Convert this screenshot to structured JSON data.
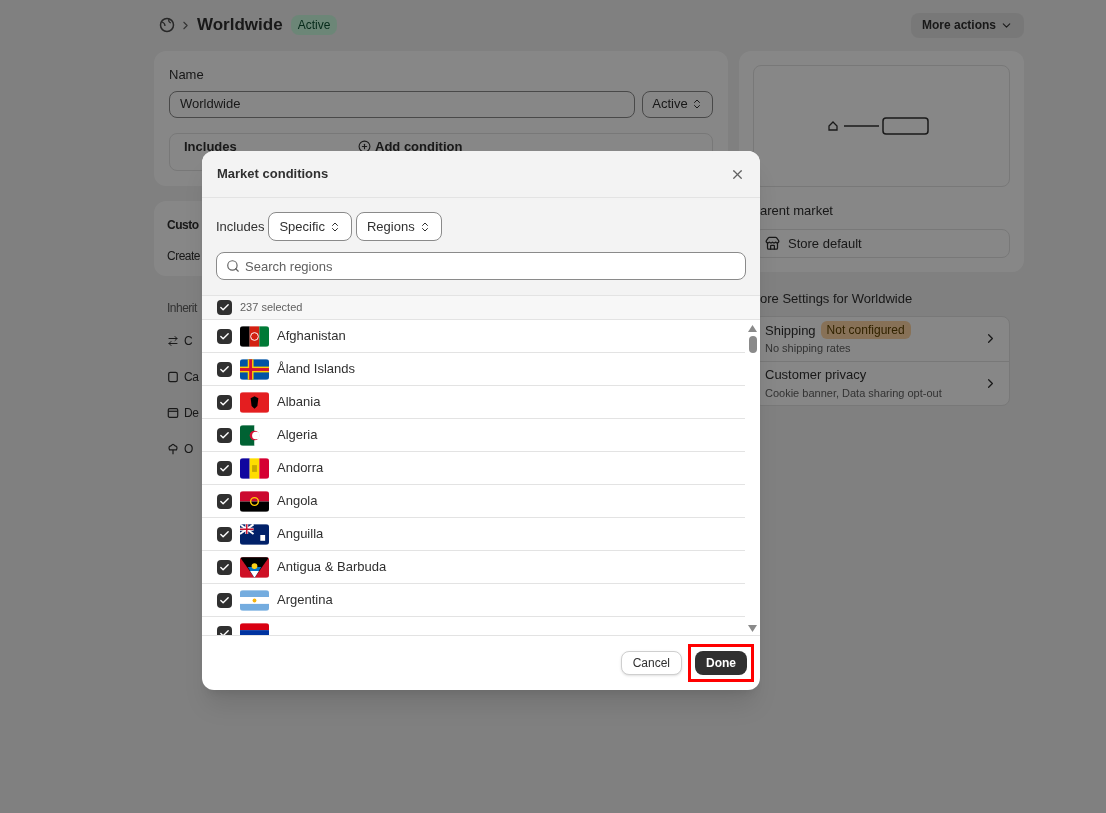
{
  "header": {
    "title": "Worldwide",
    "status": "Active",
    "more_actions": "More actions"
  },
  "name_card": {
    "label": "Name",
    "value": "Worldwide",
    "status_select": "Active",
    "includes_label": "Includes",
    "add_condition": "Add condition"
  },
  "customers_card": {
    "title": "Custo",
    "text": "Create"
  },
  "inherit": {
    "title": "Inherit",
    "items": [
      "C",
      "Ca",
      "De",
      "O"
    ]
  },
  "parent_market": {
    "label": "arent market",
    "button": "Store default"
  },
  "more_settings": {
    "title": "ore Settings for Worldwide",
    "rows": [
      {
        "title": "Shipping",
        "badge": "Not configured",
        "subtitle": "No shipping rates"
      },
      {
        "title": "Customer privacy",
        "subtitle": "Cookie banner, Data sharing opt-out"
      }
    ]
  },
  "modal": {
    "title": "Market conditions",
    "includes_label": "Includes",
    "selects": [
      "Specific",
      "Regions"
    ],
    "search_placeholder": "Search regions",
    "select_all": {
      "label": "237 selected",
      "checked": true
    },
    "countries": [
      {
        "name": "Afghanistan",
        "checked": true
      },
      {
        "name": "Åland Islands",
        "checked": true
      },
      {
        "name": "Albania",
        "checked": true
      },
      {
        "name": "Algeria",
        "checked": true
      },
      {
        "name": "Andorra",
        "checked": true
      },
      {
        "name": "Angola",
        "checked": true
      },
      {
        "name": "Anguilla",
        "checked": true
      },
      {
        "name": "Antigua & Barbuda",
        "checked": true
      },
      {
        "name": "Argentina",
        "checked": true
      },
      {
        "checked": true
      }
    ],
    "cancel": "Cancel",
    "done": "Done"
  }
}
